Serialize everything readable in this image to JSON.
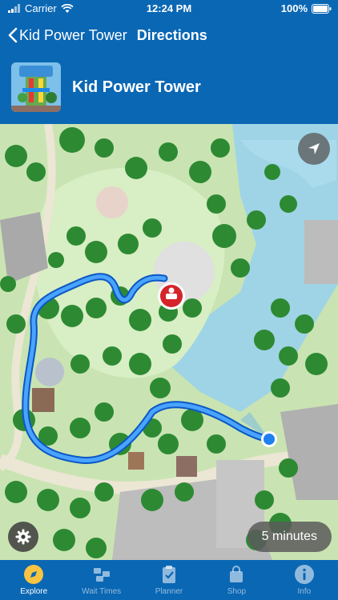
{
  "status": {
    "carrier": "Carrier",
    "time": "12:24 PM",
    "battery": "100%"
  },
  "nav": {
    "back_label": "Kid Power Tower",
    "title": "Directions"
  },
  "attraction": {
    "name": "Kid Power Tower"
  },
  "map": {
    "eta": "5 minutes",
    "route_color": "#1d7ff0",
    "destination_pin_color": "#d5232a"
  },
  "tabs": [
    {
      "label": "Explore",
      "icon": "compass-icon",
      "active": true
    },
    {
      "label": "Wait Times",
      "icon": "blocks-icon",
      "active": false
    },
    {
      "label": "Planner",
      "icon": "clipboard-icon",
      "active": false
    },
    {
      "label": "Shop",
      "icon": "shopping-bag-icon",
      "active": false
    },
    {
      "label": "Info",
      "icon": "info-icon",
      "active": false
    }
  ],
  "colors": {
    "header": "#0a67b4",
    "water": "#9fd4e6",
    "grass": "#c9e4b2",
    "tree": "#2d8a33"
  }
}
